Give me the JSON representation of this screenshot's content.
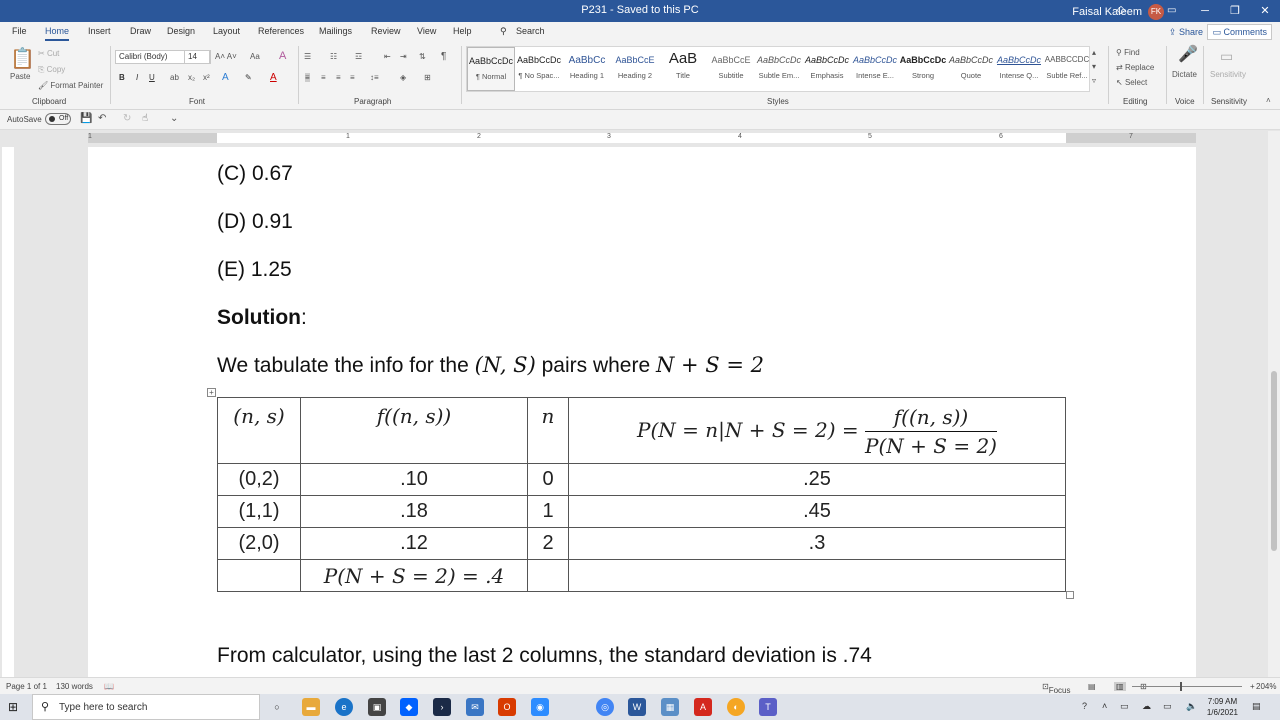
{
  "window": {
    "title": "P231  -  Saved to this PC",
    "user_name": "Faisal Kaleem",
    "user_initials": "FK"
  },
  "tabs": [
    "File",
    "Home",
    "Insert",
    "Draw",
    "Design",
    "Layout",
    "References",
    "Mailings",
    "Review",
    "View",
    "Help"
  ],
  "search_label": "Search",
  "share_label": "Share",
  "comments_label": "Comments",
  "ribbon": {
    "clipboard": {
      "paste": "Paste",
      "cut": "Cut",
      "copy": "Copy",
      "format_painter": "Format Painter",
      "label": "Clipboard"
    },
    "font": {
      "name": "Calibri (Body)",
      "size": "14",
      "label": "Font"
    },
    "paragraph_label": "Paragraph",
    "styles": [
      {
        "preview": "AaBbCcDc",
        "name": "¶ Normal"
      },
      {
        "preview": "AaBbCcDc",
        "name": "¶ No Spac..."
      },
      {
        "preview": "AaBbCc",
        "name": "Heading 1"
      },
      {
        "preview": "AaBbCcE",
        "name": "Heading 2"
      },
      {
        "preview": "AaB",
        "name": "Title"
      },
      {
        "preview": "AaBbCcE",
        "name": "Subtitle"
      },
      {
        "preview": "AaBbCcDc",
        "name": "Subtle Em..."
      },
      {
        "preview": "AaBbCcDc",
        "name": "Emphasis"
      },
      {
        "preview": "AaBbCcDc",
        "name": "Intense E..."
      },
      {
        "preview": "AaBbCcDc",
        "name": "Strong"
      },
      {
        "preview": "AaBbCcDc",
        "name": "Quote"
      },
      {
        "preview": "AaBbCcDc",
        "name": "Intense Q..."
      },
      {
        "preview": "AABBCCDC",
        "name": "Subtle Ref..."
      }
    ],
    "styles_label": "Styles",
    "editing": {
      "find": "Find",
      "replace": "Replace",
      "select": "Select",
      "label": "Editing"
    },
    "voice": {
      "dictate": "Dictate",
      "label": "Voice"
    },
    "sensitivity": {
      "name": "Sensitivity",
      "label": "Sensitivity"
    }
  },
  "qat": {
    "autosave": "AutoSave",
    "toggle": "Off"
  },
  "document": {
    "options": [
      "(C) 0.67",
      "(D) 0.91",
      "(E) 1.25"
    ],
    "solution_heading": "Solution",
    "solution_colon": ":",
    "intro_prefix": "We tabulate the info for the ",
    "intro_pair": "(N, S)",
    "intro_middle": " pairs where ",
    "intro_eq": "N + S = 2",
    "table": {
      "headers": [
        "(n, s)",
        "f((n, s))",
        "n"
      ],
      "header4_left": "P(N = n|N + S = 2) =",
      "header4_num": "f((n, s))",
      "header4_den": "P(N + S = 2)",
      "rows": [
        {
          "pair": "(0,2)",
          "f": ".10",
          "n": "0",
          "p": ".25"
        },
        {
          "pair": "(1,1)",
          "f": ".18",
          "n": "1",
          "p": ".45"
        },
        {
          "pair": "(2,0)",
          "f": ".12",
          "n": "2",
          "p": ".3"
        }
      ],
      "total": "P(N + S = 2) = .4"
    },
    "conclusion": "From calculator, using the last 2 columns, the standard deviation is .74"
  },
  "ruler_numbers": [
    "1",
    "1",
    "2",
    "3",
    "4",
    "5",
    "6",
    "7"
  ],
  "status": {
    "page": "Page 1 of 1",
    "words": "130 words",
    "focus": "Focus",
    "zoom": "204%"
  },
  "taskbar": {
    "search_placeholder": "Type here to search",
    "time": "7:09 AM",
    "date": "1/6/2021"
  }
}
